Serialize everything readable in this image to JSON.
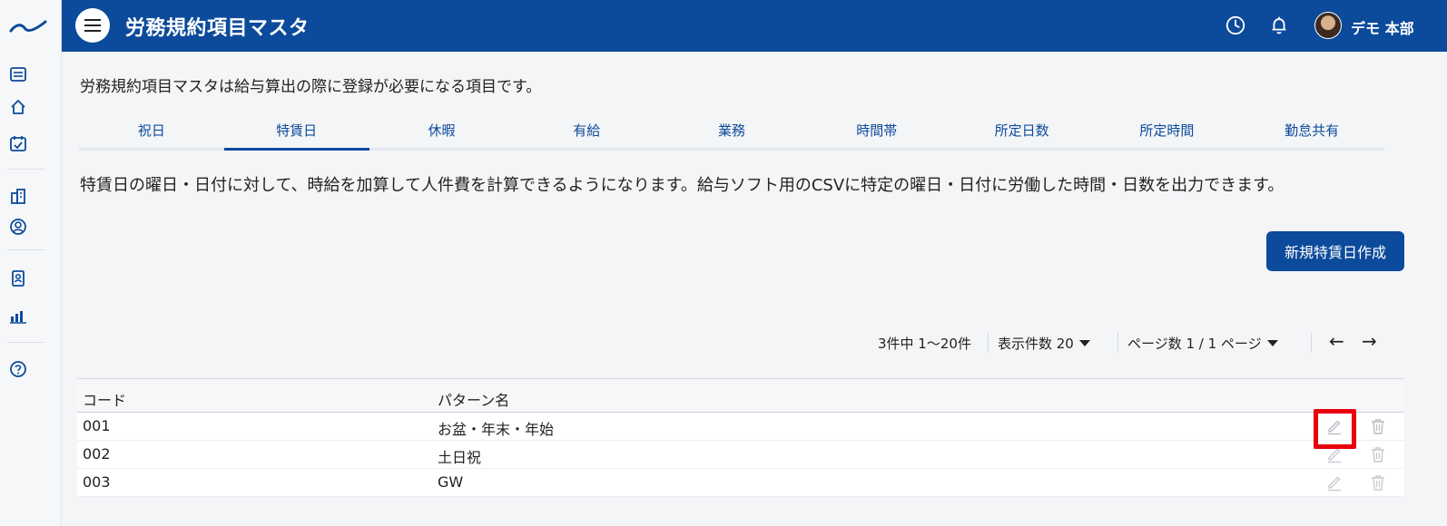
{
  "header": {
    "title": "労務規約項目マスタ",
    "user_name": "デモ 本部"
  },
  "page": {
    "description": "労務規約項目マスタは給与算出の際に登録が必要になる項目です。",
    "sub_description": "特賃日の曜日・日付に対して、時給を加算して人件費を計算できるようになります。給与ソフト用のCSVに特定の曜日・日付に労働した時間・日数を出力できます。",
    "create_button": "新規特賃日作成"
  },
  "tabs": [
    {
      "label": "祝日"
    },
    {
      "label": "特賃日",
      "active": true
    },
    {
      "label": "休暇"
    },
    {
      "label": "有給"
    },
    {
      "label": "業務"
    },
    {
      "label": "時間帯"
    },
    {
      "label": "所定日数"
    },
    {
      "label": "所定時間"
    },
    {
      "label": "勤怠共有"
    }
  ],
  "pager": {
    "range": "3件中 1〜20件",
    "per_page": "表示件数 20",
    "page": "ページ数 1 / 1 ページ",
    "prev": "←",
    "next": "→"
  },
  "table": {
    "columns": [
      "コード",
      "パターン名"
    ],
    "rows": [
      {
        "code": "001",
        "name": "お盆・年末・年始"
      },
      {
        "code": "002",
        "name": "土日祝"
      },
      {
        "code": "003",
        "name": "GW"
      }
    ]
  },
  "colors": {
    "brand": "#0c4a9b",
    "highlight": "#e8000b"
  }
}
